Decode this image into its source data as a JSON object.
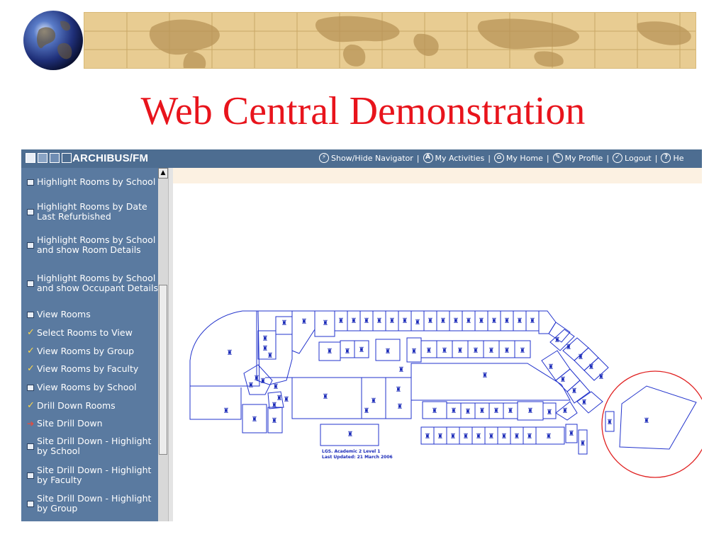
{
  "slide": {
    "title": "Web Central Demonstration"
  },
  "app": {
    "brand": "ARCHIBUS/FM",
    "nav": [
      {
        "icon": "lightning-icon",
        "glyph": "⚡",
        "label": "Show/Hide Navigator"
      },
      {
        "icon": "activities-icon",
        "glyph": "A",
        "label": "My Activities"
      },
      {
        "icon": "home-icon",
        "glyph": "⌂",
        "label": "My Home"
      },
      {
        "icon": "profile-icon",
        "glyph": "✎",
        "label": "My Profile"
      },
      {
        "icon": "logout-icon",
        "glyph": "✓",
        "label": "Logout"
      },
      {
        "icon": "help-icon",
        "glyph": "?",
        "label": "He"
      }
    ]
  },
  "sidebar": {
    "items": [
      {
        "label": "Highlight Rooms by School",
        "marker": "doc"
      },
      {
        "label": "Highlight Rooms by Date Last Refurbished",
        "marker": "doc"
      },
      {
        "label": "Highlight Rooms by School and show Room Details",
        "marker": "doc"
      },
      {
        "label": "Highlight Rooms by School and show Occupant Details",
        "marker": "doc"
      },
      {
        "label": "View Rooms",
        "marker": "doc"
      },
      {
        "label": "Select Rooms to View",
        "marker": "check"
      },
      {
        "label": "View Rooms by Group",
        "marker": "check"
      },
      {
        "label": "View Rooms by Faculty",
        "marker": "check"
      },
      {
        "label": "View Rooms by School",
        "marker": "doc"
      },
      {
        "label": "Drill Down Rooms",
        "marker": "check"
      },
      {
        "label": "Site Drill Down",
        "marker": "arrow"
      },
      {
        "label": "Site Drill Down - Highlight by School",
        "marker": "doc"
      },
      {
        "label": "Site Drill Down - Highlight by Faculty",
        "marker": "doc"
      },
      {
        "label": "Site Drill Down - Highlight by Group",
        "marker": "doc"
      }
    ]
  },
  "floorplan": {
    "caption_line1": "LGS. Academic 2 Level 1",
    "caption_line2": "Last Updated: 21 March 2006"
  },
  "colors": {
    "title": "#e8141c",
    "topbar": "#4d6d91",
    "sidebar": "#5a7aa0",
    "plan_line": "#2233cc",
    "highlight_circle": "#e02020"
  }
}
